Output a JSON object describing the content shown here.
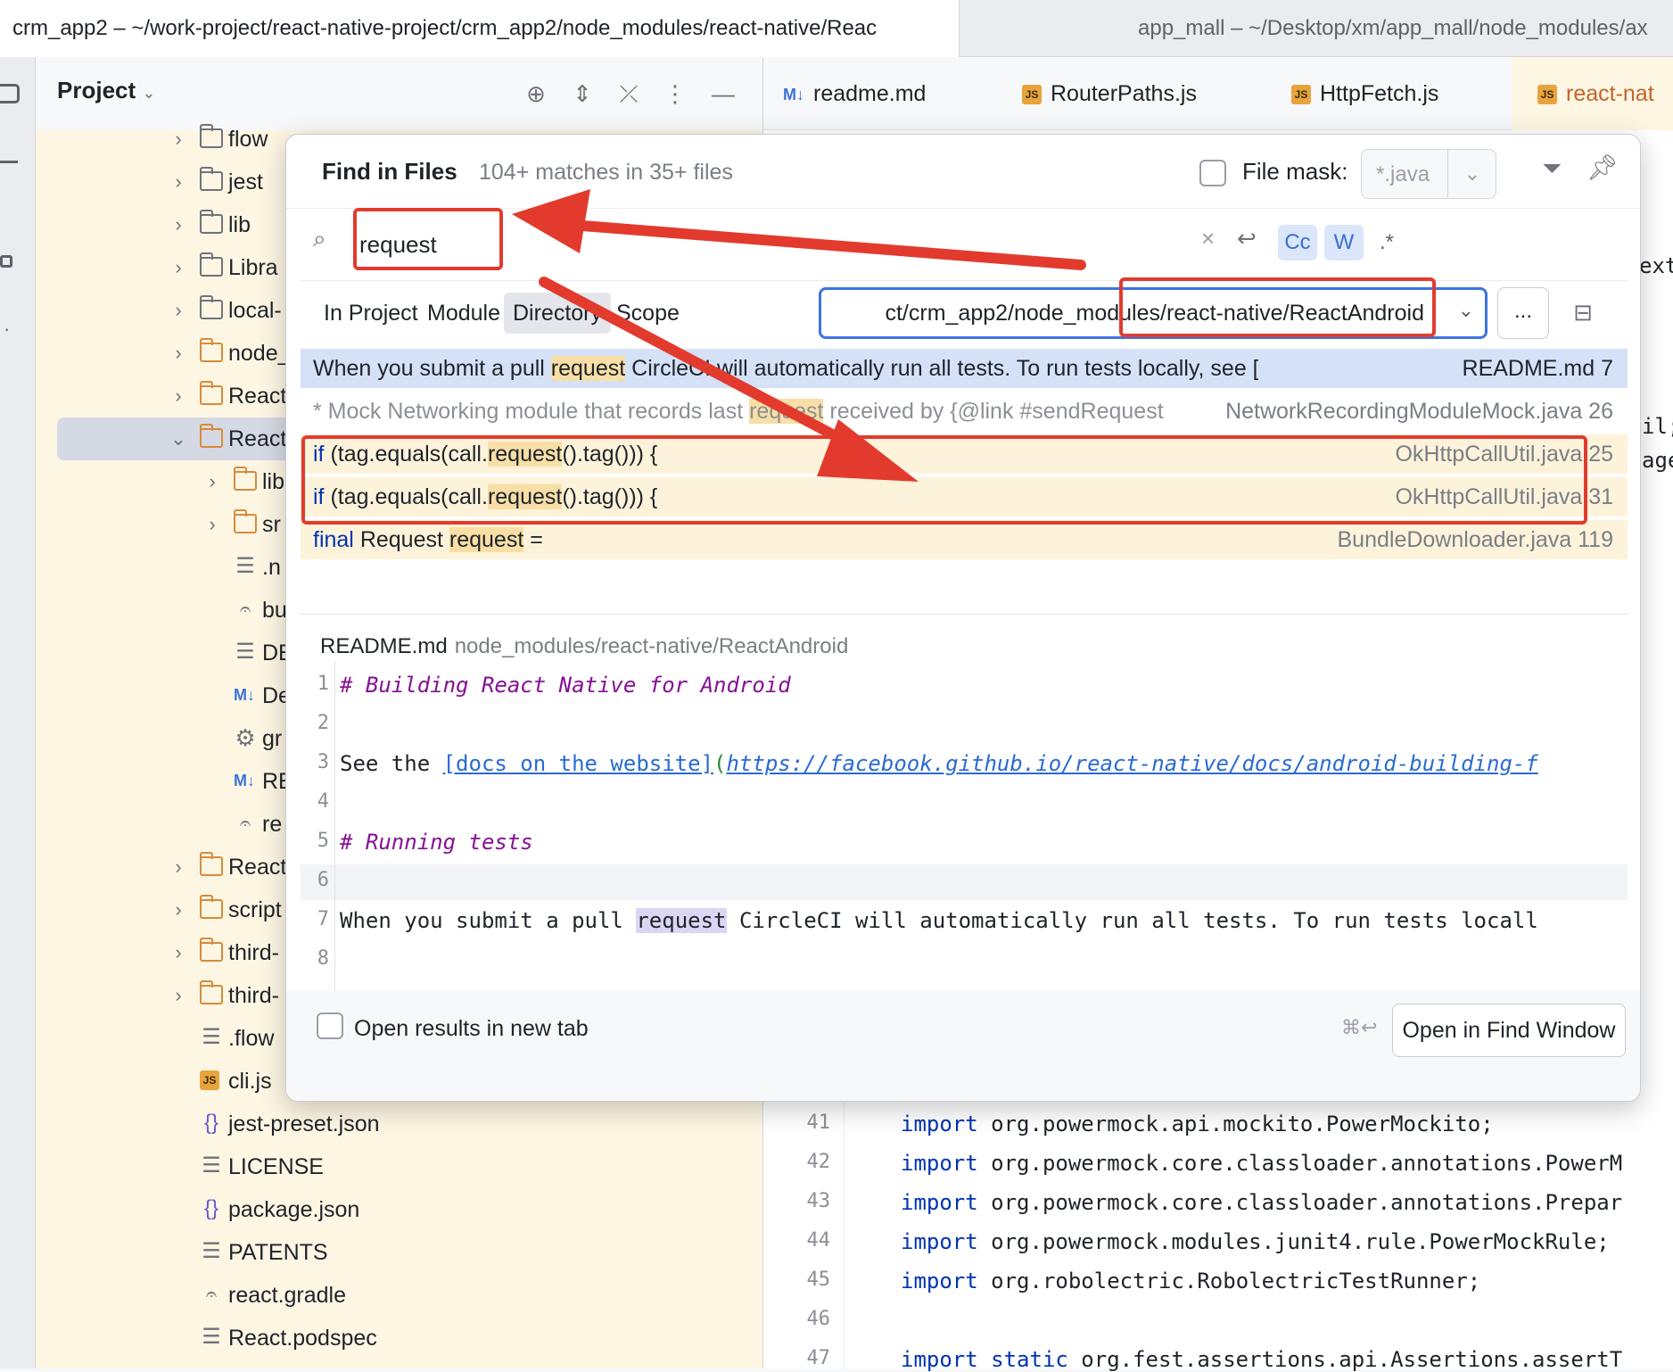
{
  "window_tabs": [
    "crm_app2 – ~/work-project/react-native-project/crm_app2/node_modules/react-native/Reac",
    "app_mall – ~/Desktop/xm/app_mall/node_modules/ax"
  ],
  "project_panel": {
    "title": "Project",
    "tree": [
      {
        "label": "flow",
        "type": "folder",
        "collapsed": true
      },
      {
        "label": "jest",
        "type": "folder",
        "collapsed": true
      },
      {
        "label": "lib",
        "type": "folder",
        "collapsed": true
      },
      {
        "label": "Libra",
        "type": "folder",
        "collapsed": true
      },
      {
        "label": "local-",
        "type": "folder",
        "collapsed": true
      },
      {
        "label": "node_",
        "type": "folder-orange",
        "collapsed": true
      },
      {
        "label": "React",
        "type": "folder-orange",
        "collapsed": true
      },
      {
        "label": "React",
        "type": "folder-orange",
        "expanded": true
      },
      {
        "label": "lib",
        "type": "folder-orange",
        "collapsed": true
      },
      {
        "label": "sr",
        "type": "folder-orange",
        "collapsed": true
      },
      {
        "label": ".n",
        "type": "lines"
      },
      {
        "label": "bu",
        "type": "gradle"
      },
      {
        "label": "DE",
        "type": "lines"
      },
      {
        "label": "De",
        "type": "md"
      },
      {
        "label": "gr",
        "type": "gear"
      },
      {
        "label": "RE",
        "type": "md"
      },
      {
        "label": "re",
        "type": "gradle"
      },
      {
        "label": "React",
        "type": "folder-orange",
        "collapsed": true
      },
      {
        "label": "script",
        "type": "folder-orange",
        "collapsed": true
      },
      {
        "label": "third-",
        "type": "folder-orange",
        "collapsed": true
      },
      {
        "label": "third-",
        "type": "folder-orange",
        "collapsed": true
      },
      {
        "label": ".flow",
        "type": "lines"
      },
      {
        "label": "cli.js",
        "type": "js"
      },
      {
        "label": "jest-preset.json",
        "type": "json"
      },
      {
        "label": "LICENSE",
        "type": "lines"
      },
      {
        "label": "package.json",
        "type": "json"
      },
      {
        "label": "PATENTS",
        "type": "lines"
      },
      {
        "label": "react.gradle",
        "type": "gradle"
      },
      {
        "label": "React.podspec",
        "type": "lines"
      }
    ]
  },
  "editor": {
    "tabs": [
      {
        "label": "readme.md",
        "icon": "md"
      },
      {
        "label": "RouterPaths.js",
        "icon": "js"
      },
      {
        "label": "HttpFetch.js",
        "icon": "js"
      },
      {
        "label": "react-nat",
        "icon": "js"
      }
    ],
    "side_fragments": [
      "ext",
      "il;",
      "age"
    ],
    "code_lines": [
      {
        "num": "41",
        "kw": "import",
        "text": " org.powermock.api.mockito.PowerMockito;"
      },
      {
        "num": "42",
        "kw": "import",
        "text": " org.powermock.core.classloader.annotations.PowerM"
      },
      {
        "num": "43",
        "kw": "import",
        "text": " org.powermock.core.classloader.annotations.Prepar"
      },
      {
        "num": "44",
        "kw": "import",
        "text": " org.powermock.modules.junit4.rule.PowerMockRule;"
      },
      {
        "num": "45",
        "kw": "import",
        "text": " org.robolectric.RobolectricTestRunner;"
      },
      {
        "num": "46",
        "kw": "",
        "text": ""
      },
      {
        "num": "47",
        "kw": "import static",
        "text": " org.fest.assertions.api.Assertions.assertT"
      }
    ]
  },
  "find": {
    "title": "Find in Files",
    "count": "104+ matches in 35+ files",
    "file_mask_label": "File mask:",
    "file_mask_value": "*.java",
    "query": "request",
    "options": {
      "case": "Cc",
      "words": "W",
      "regex": ".*"
    },
    "scopes": [
      {
        "label": "In Project",
        "mnemonic": "P"
      },
      {
        "label": "Module",
        "mnemonic": "M"
      },
      {
        "label": "Directory",
        "mnemonic": "D",
        "active": true
      },
      {
        "label": "Scope",
        "mnemonic": "S"
      }
    ],
    "directory": "ct/crm_app2/node_modules/react-native/ReactAndroid",
    "browse": "...",
    "results": [
      {
        "pre": "When you submit a pull ",
        "match": "request",
        "post": " CircleCI will automatically run all tests. To run tests locally, see [Testing](h",
        "file": "README.md 7",
        "style": "selected"
      },
      {
        "pre": "* Mock Networking module that records last ",
        "match": "request",
        "post": " received by {@link #sendRequest",
        "file": "NetworkRecordingModuleMock.java 26",
        "style": "comment"
      },
      {
        "pre_kw": "if",
        "pre": " (tag.equals(call.",
        "match": "request",
        "post": "().tag())) {",
        "file": "OkHttpCallUtil.java 25",
        "style": "yellow"
      },
      {
        "pre_kw": "if",
        "pre": " (tag.equals(call.",
        "match": "request",
        "post": "().tag())) {",
        "file": "OkHttpCallUtil.java 31",
        "style": "yellow"
      },
      {
        "pre_kw": "final",
        "pre": " Request ",
        "match": "request",
        "post": " =",
        "file": "BundleDownloader.java 119",
        "style": "yellow"
      }
    ],
    "preview": {
      "file": "README.md",
      "path": "node_modules/react-native/ReactAndroid",
      "lines": [
        {
          "num": "1",
          "text": "# Building React Native for Android"
        },
        {
          "num": "2",
          "text": ""
        },
        {
          "num": "3",
          "pre": "See the ",
          "link": "[docs on the website]",
          "paren": "(",
          "url": "https://facebook.github.io/react-native/docs/android-building-f"
        },
        {
          "num": "4",
          "text": ""
        },
        {
          "num": "5",
          "text": "# Running tests"
        },
        {
          "num": "6",
          "text": ""
        },
        {
          "num": "7",
          "pre": "When you submit a pull ",
          "match": "request",
          "post": " CircleCI will automatically run all tests. To run tests locall"
        },
        {
          "num": "8",
          "text": ""
        }
      ]
    },
    "open_new_tab_label": "Open results in new tab",
    "shortcut": "⌘↩",
    "open_find_window": "Open in Find Window"
  },
  "annotation_color": "#e23b2e"
}
